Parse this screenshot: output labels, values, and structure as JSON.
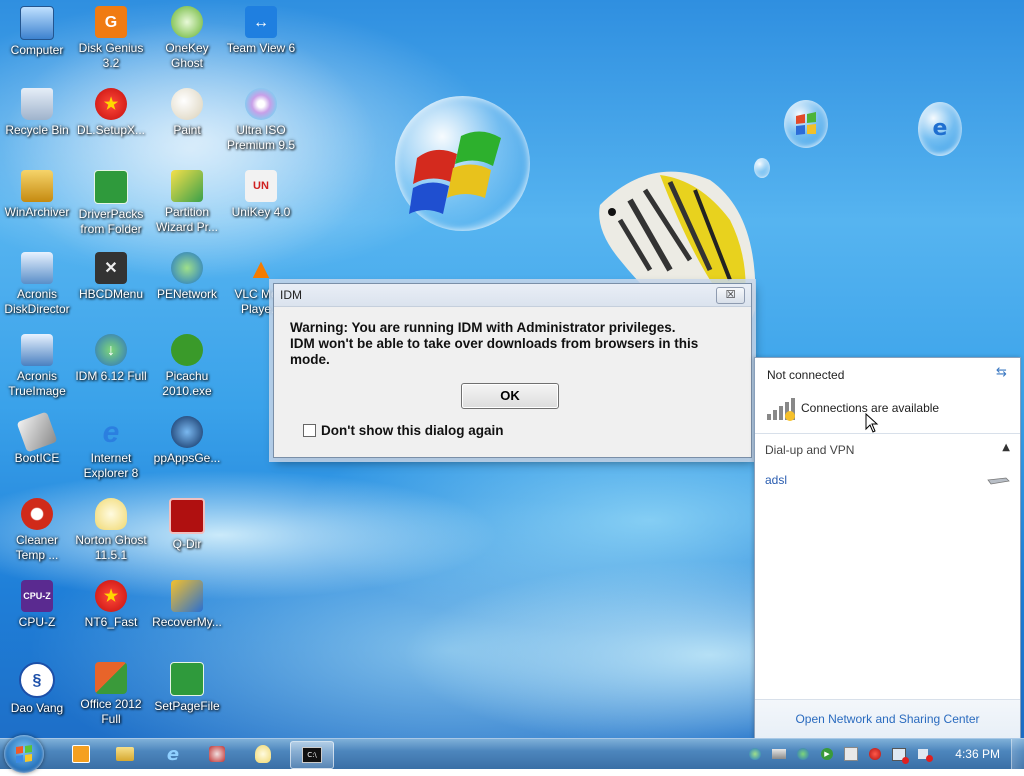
{
  "desktop_icons": [
    {
      "label": "Computer",
      "icon": "computer-icon"
    },
    {
      "label": "Disk Genius 3.2",
      "icon": "disk-genius-icon"
    },
    {
      "label": "OneKey Ghost",
      "icon": "onekey-ghost-icon"
    },
    {
      "label": "Team View 6",
      "icon": "teamviewer-icon"
    },
    {
      "label": "Recycle Bin",
      "icon": "recycle-bin-icon"
    },
    {
      "label": "DL.SetupX...",
      "icon": "dl-setup-icon"
    },
    {
      "label": "Paint",
      "icon": "paint-icon"
    },
    {
      "label": "Ultra ISO Premium 9.5",
      "icon": "ultraiso-icon"
    },
    {
      "label": "WinArchiver",
      "icon": "winarchiver-icon"
    },
    {
      "label": "DriverPacks from Folder",
      "icon": "driverpacks-icon"
    },
    {
      "label": "Partition Wizard Pr...",
      "icon": "partition-wizard-icon"
    },
    {
      "label": "UniKey 4.0",
      "icon": "unikey-icon"
    },
    {
      "label": "Acronis DiskDirector",
      "icon": "acronis-diskdirector-icon"
    },
    {
      "label": "HBCDMenu",
      "icon": "hbcdmenu-icon"
    },
    {
      "label": "PENetwork",
      "icon": "penetwork-icon"
    },
    {
      "label": "VLC Me... Playe...",
      "icon": "vlc-icon"
    },
    {
      "label": "Acronis TrueImage",
      "icon": "acronis-trueimage-icon"
    },
    {
      "label": "IDM 6.12 Full",
      "icon": "idm-icon"
    },
    {
      "label": "Picachu 2010.exe",
      "icon": "picachu-icon"
    },
    {
      "label": "BootICE",
      "icon": "bootice-icon"
    },
    {
      "label": "Internet Explorer 8",
      "icon": "internet-explorer-icon"
    },
    {
      "label": "ppAppsGe...",
      "icon": "ppapps-icon"
    },
    {
      "label": "Cleaner Temp ...",
      "icon": "ccleaner-icon"
    },
    {
      "label": "Norton Ghost 11.5.1",
      "icon": "norton-ghost-icon"
    },
    {
      "label": "Q-Dir",
      "icon": "qdir-icon"
    },
    {
      "label": "CPU-Z",
      "icon": "cpuz-icon"
    },
    {
      "label": "NT6_Fast",
      "icon": "nt6-fast-icon"
    },
    {
      "label": "RecoverMy...",
      "icon": "recovermy-icon"
    },
    {
      "label": "Dao Vang",
      "icon": "dao-vang-icon"
    },
    {
      "label": "Office 2012 Full",
      "icon": "office-icon"
    },
    {
      "label": "SetPageFile",
      "icon": "setpagefile-icon"
    }
  ],
  "idm_dialog": {
    "title": "IDM",
    "message_line1": "Warning: You are running IDM with Administrator privileges.",
    "message_line2": "IDM won't be able to take over downloads from browsers in this",
    "message_line3": "mode.",
    "ok_label": "OK",
    "checkbox_label": "Don't show this dialog again",
    "checkbox_checked": false,
    "close_glyph": "☒"
  },
  "network_panel": {
    "status": "Not connected",
    "available_text": "Connections are available",
    "section_title": "Dial-up and VPN",
    "connections": [
      "adsl"
    ],
    "footer_link": "Open Network and Sharing Center"
  },
  "taskbar": {
    "clock": "4:36 PM",
    "pinned": [
      "media-player-icon",
      "file-explorer-icon",
      "internet-explorer-icon",
      "network-tool-icon",
      "ghost-icon",
      "command-prompt-icon"
    ],
    "active_item": "command-prompt-icon"
  },
  "colors": {
    "link": "#2a6bbf",
    "dialog_bg": "#f0f0f0",
    "taskbar": "#3a6fa6"
  }
}
